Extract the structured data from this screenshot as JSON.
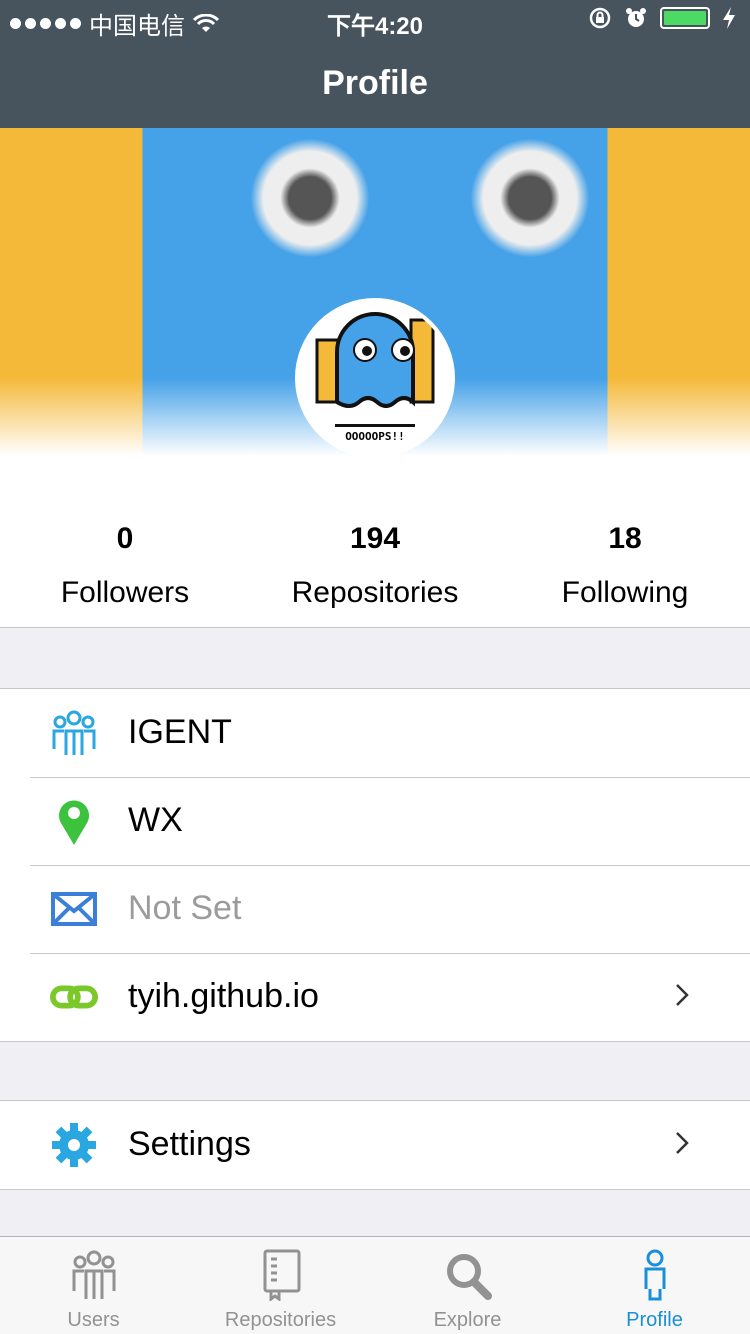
{
  "status_bar": {
    "carrier": "中国电信",
    "time": "下午4:20"
  },
  "nav": {
    "title": "Profile"
  },
  "stats": [
    {
      "value": "0",
      "label": "Followers"
    },
    {
      "value": "194",
      "label": "Repositories"
    },
    {
      "value": "18",
      "label": "Following"
    }
  ],
  "avatar": {
    "text": "OOOOOPS!!"
  },
  "info": [
    {
      "icon": "people-icon",
      "text": "IGENT",
      "muted": false
    },
    {
      "icon": "location-pin-icon",
      "text": "WX",
      "muted": false
    },
    {
      "icon": "mail-icon",
      "text": "Not Set",
      "muted": true
    },
    {
      "icon": "link-icon",
      "text": "tyih.github.io",
      "muted": false
    }
  ],
  "settings": {
    "icon": "gear-icon",
    "text": "Settings"
  },
  "tabs": [
    {
      "icon": "users-tab-icon",
      "label": "Users"
    },
    {
      "icon": "book-tab-icon",
      "label": "Repositories"
    },
    {
      "icon": "search-tab-icon",
      "label": "Explore"
    },
    {
      "icon": "profile-tab-icon",
      "label": "Profile",
      "active": true
    }
  ],
  "colors": {
    "nav_bg": "#47535d",
    "active_tab": "#1a8fd9",
    "people_icon": "#2aa6e0",
    "pin_icon": "#3cc23c",
    "mail_icon": "#3b7fd9",
    "link_icon": "#7bc82b",
    "gear_icon": "#2aa6e0",
    "battery": "#4cd964"
  },
  "battery_level": 1.0
}
